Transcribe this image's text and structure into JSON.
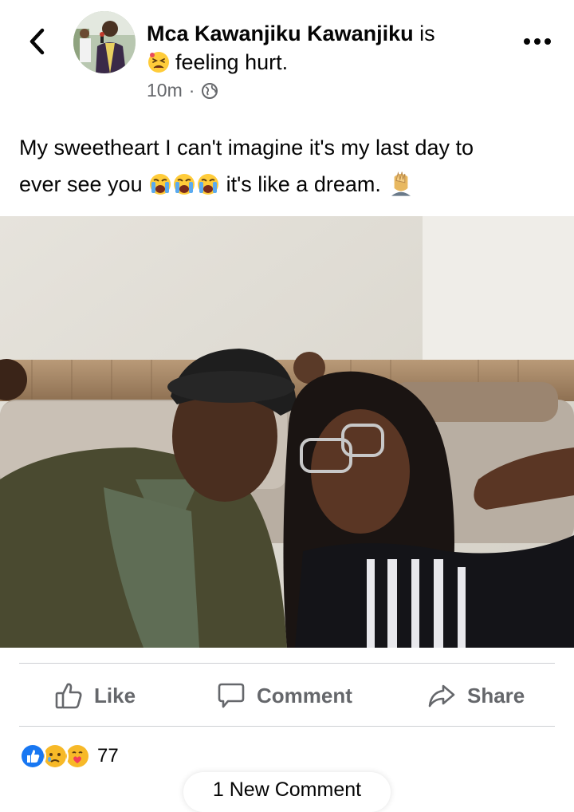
{
  "post": {
    "author": "Mca Kawanjiku Kawanjiku",
    "is_word": "is",
    "feeling": "feeling hurt.",
    "feeling_icon": "tired-face-emoji",
    "time": "10m",
    "dot": "·",
    "privacy_icon": "globe-icon",
    "text_line1": "My sweetheart I can't imagine it's my last day to",
    "text_line2_a": "ever see you",
    "text_line2_b": "it's like a dream.",
    "emojis": [
      "loudly-crying-face",
      "loudly-crying-face",
      "loudly-crying-face",
      "facepalm"
    ],
    "photo": "selfie-of-couple-on-sofa"
  },
  "actions": {
    "like": "Like",
    "comment": "Comment",
    "share": "Share"
  },
  "reactions": {
    "icons": [
      "like-reaction",
      "sad-reaction",
      "care-reaction"
    ],
    "count": "77"
  },
  "comments": {
    "new_label": "1 New Comment"
  },
  "colors": {
    "secondary_text": "#65676b",
    "like_blue": "#1877f2",
    "divider": "#ced0d4"
  }
}
